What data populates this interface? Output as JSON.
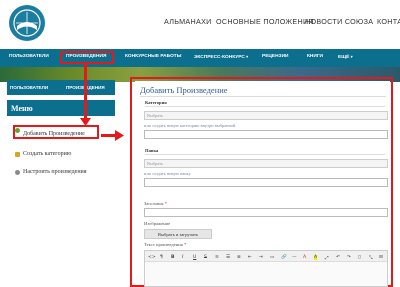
{
  "header": {
    "logo_icon": "union-globe-book-logo",
    "nav": [
      "АЛЬМАНАХИ",
      "ОСНОВНЫЕ ПОЛОЖЕНИЯ",
      "НОВОСТИ СОЮЗА",
      "КОНТАКТЫ"
    ]
  },
  "navbar": {
    "items": [
      "ПОЛЬЗОВАТЕЛИ",
      "ПРОИЗВЕДЕНИЯ",
      "КОНКУРСНЫЕ РАБОТЫ",
      "ЭКСПРЕСС-КОНКУРС",
      "РЕЦЕНЗИИ",
      "КНИГИ",
      "ЕЩЁ"
    ],
    "active": "ПРОИЗВЕДЕНИЯ",
    "caret": "▾"
  },
  "sidebar": {
    "tabs": [
      "ПОЛЬЗОВАТЕЛИ",
      "ПРОИЗВЕДЕНИЯ"
    ],
    "menu_title": "Меню",
    "items": [
      {
        "label": "Добавить Произведение",
        "icon": "plus-icon"
      },
      {
        "label": "Создать категорию",
        "icon": "folder-icon"
      },
      {
        "label": "Настроить произведения",
        "icon": "gear-icon"
      }
    ]
  },
  "form": {
    "title": "Добавить Произведение",
    "category_label": "Категория",
    "category_select": "Выбрать",
    "category_hint": "или создать новую категорию внутри выбранной",
    "folder_label": "Папка",
    "folder_select": "Выбрать",
    "folder_hint": "или создать новую папку",
    "title_label": "Заголовок",
    "required_mark": "*",
    "image_label": "Изображение",
    "upload_button": "Выбрать и загрузить",
    "text_label": "Текст произведения",
    "toolbar": [
      "<>",
      "¶",
      "B",
      "I",
      "U",
      "S",
      "≡",
      "☰",
      "≣",
      "⇤",
      "⇥",
      "▭",
      "🔗",
      "—",
      "A",
      "A",
      "⤢",
      "↶",
      "↷",
      "▯",
      "⤡",
      "⊟"
    ]
  },
  "colors": {
    "nav_bg": "#0c6f8e",
    "highlight": "#e3191c",
    "title_blue": "#2f5f8a"
  }
}
